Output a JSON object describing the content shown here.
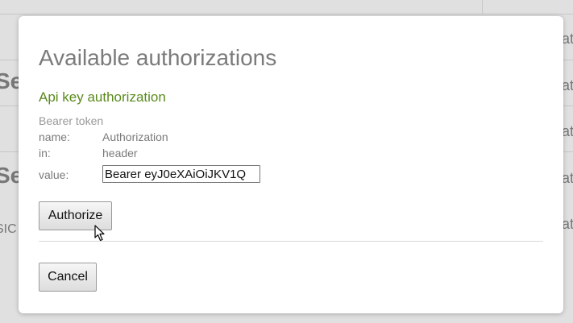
{
  "background": {
    "fragments": [
      {
        "text": "Se"
      },
      {
        "text": "Se"
      },
      {
        "text": "SIC"
      },
      {
        "text": "at"
      },
      {
        "text": "at"
      },
      {
        "text": "at"
      },
      {
        "text": "at"
      },
      {
        "text": "at"
      }
    ]
  },
  "modal": {
    "title": "Available authorizations",
    "auth": {
      "heading": "Api key authorization",
      "description": "Bearer token",
      "name_label": "name:",
      "name_value": "Authorization",
      "in_label": "in:",
      "in_value": "header",
      "value_label": "value:",
      "value_input": "Bearer eyJ0eXAiOiJKV1Q"
    },
    "authorize_label": "Authorize",
    "cancel_label": "Cancel"
  },
  "colors": {
    "heading_green": "#5a8a1c",
    "title_gray": "#7b7b7b"
  },
  "icons": {
    "cursor": "arrow-pointer-icon"
  }
}
